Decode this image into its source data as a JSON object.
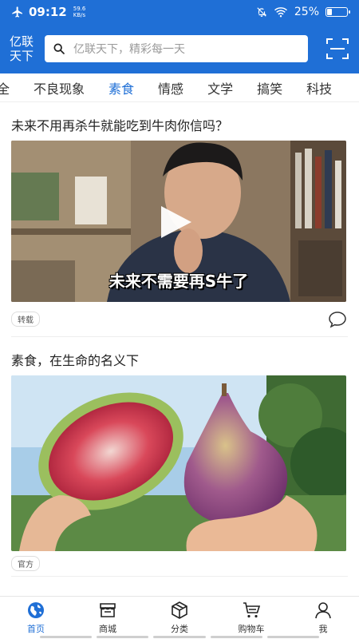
{
  "status_bar": {
    "time": "09:12",
    "speed_value": "59.6",
    "speed_unit": "KB/s",
    "battery_text": "25%",
    "battery_level": 0.25
  },
  "header": {
    "logo_line1": "亿联",
    "logo_line2": "天下",
    "search_placeholder": "亿联天下，精彩每一天"
  },
  "tabs": [
    {
      "label": "全"
    },
    {
      "label": "不良现象"
    },
    {
      "label": "素食",
      "active": true
    },
    {
      "label": "情感"
    },
    {
      "label": "文学"
    },
    {
      "label": "搞笑"
    },
    {
      "label": "科技"
    }
  ],
  "feed": [
    {
      "title": "未来不用再杀牛就能吃到牛肉你信吗？",
      "video_caption": "未来不需要再S牛了",
      "tag": "转载"
    },
    {
      "title": "素食，在生命的名义下",
      "tag": "官方"
    }
  ],
  "bottom_nav": [
    {
      "label": "首页",
      "icon": "globe-icon",
      "active": true
    },
    {
      "label": "商城",
      "icon": "store-icon"
    },
    {
      "label": "分类",
      "icon": "box-icon"
    },
    {
      "label": "购物车",
      "icon": "cart-icon"
    },
    {
      "label": "我",
      "icon": "user-icon"
    }
  ],
  "colors": {
    "brand": "#1f6fd6",
    "active_tab": "#1f6fd6"
  }
}
